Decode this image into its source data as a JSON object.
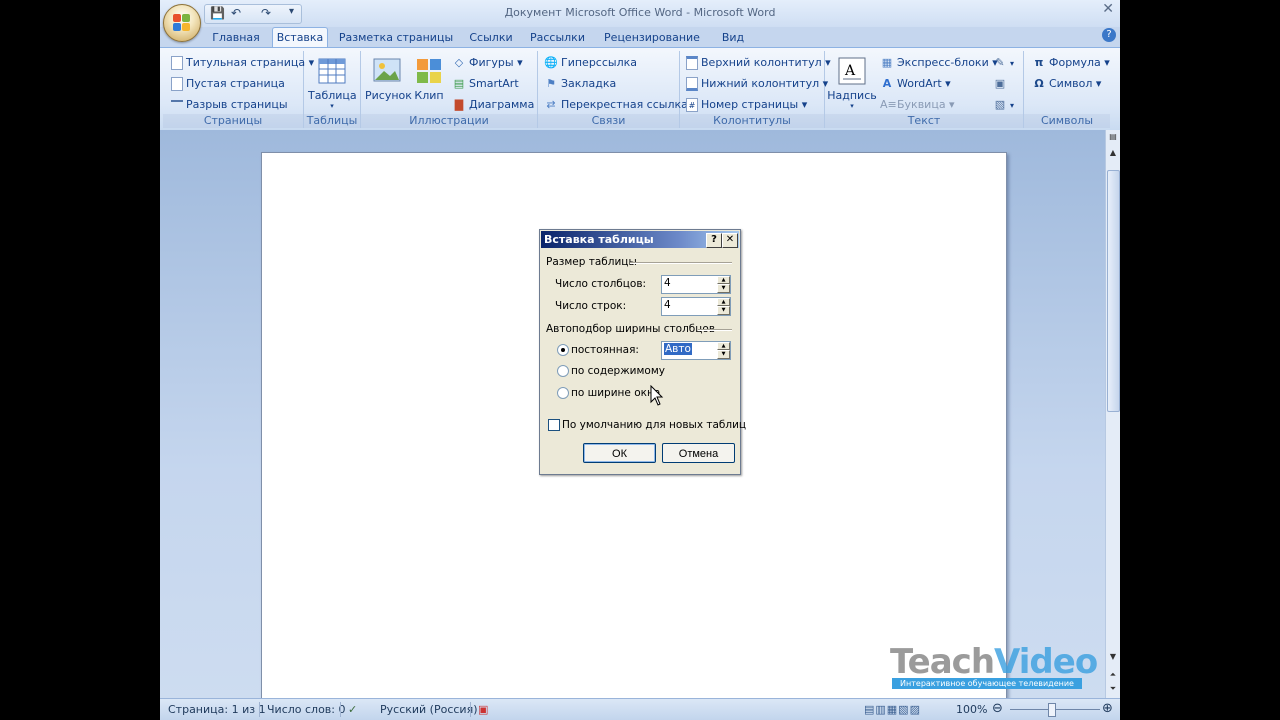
{
  "window": {
    "title": "Документ Microsoft Office Word - Microsoft Word",
    "close_glyph": "✕"
  },
  "quick_access": {
    "save_glyph": "💾",
    "undo_glyph": "↶",
    "redo_glyph": "↷",
    "customize_glyph": "▾"
  },
  "tabs": [
    "Главная",
    "Вставка",
    "Разметка страницы",
    "Ссылки",
    "Рассылки",
    "Рецензирование",
    "Вид"
  ],
  "active_tab": "Вставка",
  "help_glyph": "?",
  "ribbon": {
    "pages": {
      "label": "Страницы",
      "cover": "Титульная страница",
      "blank": "Пустая страница",
      "break": "Разрыв страницы"
    },
    "tables": {
      "label": "Таблицы",
      "table": "Таблица"
    },
    "illustrations": {
      "label": "Иллюстрации",
      "picture": "Рисунок",
      "clip": "Клип",
      "shapes": "Фигуры",
      "smartart": "SmartArt",
      "chart": "Диаграмма"
    },
    "links": {
      "label": "Связи",
      "hyperlink": "Гиперссылка",
      "bookmark": "Закладка",
      "crossref": "Перекрестная ссылка"
    },
    "header_footer": {
      "label": "Колонтитулы",
      "header": "Верхний колонтитул",
      "footer": "Нижний колонтитул",
      "page_number": "Номер страницы"
    },
    "text": {
      "label": "Текст",
      "textbox": "Надпись",
      "quickparts": "Экспресс-блоки",
      "wordart": "WordArt",
      "dropcap": "Буквица"
    },
    "symbols": {
      "label": "Символы",
      "equation": "Формула",
      "symbol": "Символ"
    }
  },
  "dialog": {
    "title": "Вставка таблицы",
    "help_glyph": "?",
    "close_glyph": "✕",
    "size_section": "Размер таблицы",
    "columns_label": "Число столбцов:",
    "columns_value": "4",
    "rows_label": "Число строк:",
    "rows_value": "4",
    "autofit_section": "Автоподбор ширины столбцов",
    "fixed_label": "постоянная:",
    "fixed_value": "Авто",
    "content_label": "по содержимому",
    "window_label": "по ширине окна",
    "default_label": "По умолчанию для новых таблиц",
    "ok": "ОК",
    "cancel": "Отмена",
    "selected_autofit": "fixed"
  },
  "statusbar": {
    "page": "Страница: 1 из 1",
    "words": "Число слов: 0",
    "language": "Русский (Россия)",
    "zoom": "100%",
    "zoom_out": "⊖",
    "zoom_in": "⊕"
  },
  "watermark": {
    "brand_part1": "Teach",
    "brand_part2": "Video",
    "tagline": "Интерактивное обучающее телевидение"
  },
  "colors": {
    "ribbon_text": "#15428b",
    "dialog_title_start": "#0a246a",
    "watermark_teach": "#6b6b6b",
    "watermark_video": "#3aa0e0"
  }
}
